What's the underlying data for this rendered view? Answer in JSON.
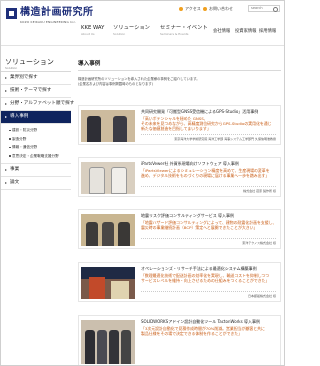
{
  "header": {
    "logo_text": "構造計画研究所",
    "logo_sub": "KOZO KEIKAKU ENGINEERING Inc.",
    "access": "アクセス",
    "contact": "お問い合わせ",
    "search_placeholder": "search"
  },
  "gnav": [
    {
      "label": "KKE WAY",
      "sub": "About Us"
    },
    {
      "label": "ソリューション",
      "sub": "Solution"
    },
    {
      "label": "セミナー・イベント",
      "sub": "Seminars & Events"
    }
  ],
  "gnav_rest": [
    "会社情報",
    "投資家情報",
    "採用情報"
  ],
  "sidebar": {
    "title": "ソリューション",
    "title_sub": "Solution",
    "items": [
      {
        "label": "業界別で探す"
      },
      {
        "label": "技術・テーマで探す"
      },
      {
        "label": "分野・アルファベット順で探す"
      },
      {
        "label": "導入事例"
      }
    ],
    "subs": [
      "建設・防災分野",
      "製造分野",
      "情報・通信分野",
      "意思決定・企業戦略支援分野"
    ],
    "items2": [
      {
        "label": "事業"
      },
      {
        "label": "論文"
      }
    ]
  },
  "main": {
    "title": "導入事例",
    "intro": "構造計画研究所のソリューションを導入された企業様の事例をご紹介しています。\n(企業名および内容は事例掲載時のものとなります)",
    "cards": [
      {
        "title": "共同研究開発「可搬型GNSS受信機によるGPS-Studio」活用事例",
        "lead": "「高いポテンシャルを秘めた GNSS、\nその未来を見つめながら、高精度測位研究からGPS-Studioの実用化を通じ\n新たな価値創造を目指してまいります」",
        "foot": "東京海洋大学学術研究院 海洋工学部 海事システム工学部門 久保信明准教授"
      },
      {
        "title": "iPartsVewer社 外資系現場向けソフトウェア 導入事例",
        "lead": "「iPartsViewerによるシミュレーション精度を高めて、生産現場の変革を\n進め、デジタル技術をものづくりの現場に届ける事業へ一歩を踏み出す」",
        "foot": "株式会社 荏原 製作所 様"
      },
      {
        "title": "地震リスク評価コンサルティングサービス 導入事例",
        "lead": "「地震ハザード評価コンサルティングによって、建物の耐震化計画を支援し、\n震災時の事業継続計画（BCP）策定へと展開できたことが大きい」",
        "foot": "東洋テクノス株式会社 様"
      },
      {
        "title": "オペレーションズ・リサーチ手法による最適化システム構築事例",
        "lead": "「数理最適化技術で配送計画の効率化を実現し、輸送コストを抑制しつつ\nサービスレベルを維持・向上させるための仕組みをつくることができた」",
        "foot": "日本郵船株式会社 様"
      },
      {
        "title": "SOLIDWORKSアドイン設計自動化ツール TactonWorks 導入事例",
        "lead": "「3次元設計自動化で見積作成時間が70%削減。営業担当が顧客と共に\n製品仕様をその場で決定できる体制を作ることができた」",
        "foot": ""
      }
    ]
  },
  "colors": {
    "brand": "#1f2f7a",
    "nav_active": "#0f245e",
    "lead_text": "#c85a12"
  }
}
